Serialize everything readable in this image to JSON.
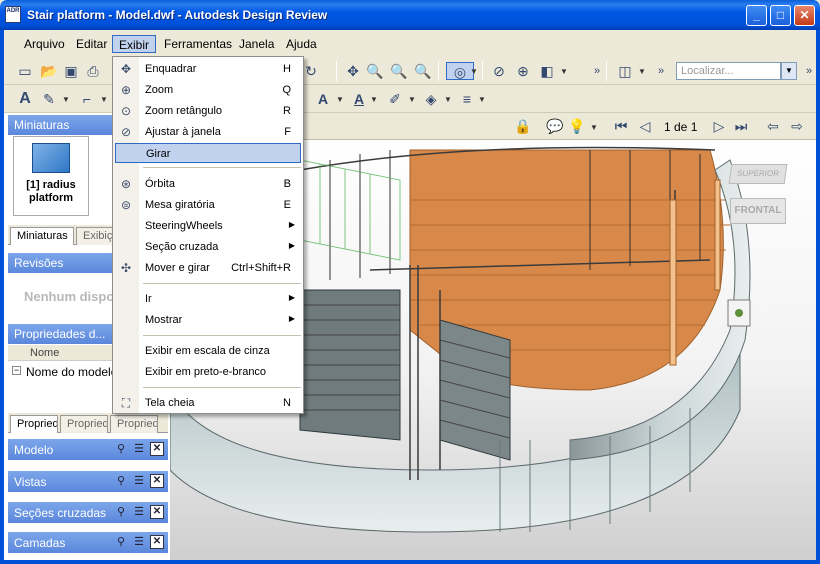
{
  "window": {
    "icon_text": "ADR",
    "title": "Stair platform - Model.dwf - Autodesk Design Review",
    "minimize": "_",
    "maximize": "□",
    "close": "✕"
  },
  "menubar": [
    {
      "label": "Arquivo",
      "key": "menu-arquivo"
    },
    {
      "label": "Editar",
      "key": "menu-editar"
    },
    {
      "label": "Exibir",
      "key": "menu-exibir"
    },
    {
      "label": "Ferramentas",
      "key": "menu-ferramentas"
    },
    {
      "label": "Janela",
      "key": "menu-janela"
    },
    {
      "label": "Ajuda",
      "key": "menu-ajuda"
    }
  ],
  "toolbar": {
    "search_placeholder": "Localizar...",
    "page_indicator": "1 de 1"
  },
  "exibir_menu": [
    {
      "label": "Enquadrar",
      "shortcut": "H",
      "icon": "pan-icon"
    },
    {
      "label": "Zoom",
      "shortcut": "Q",
      "icon": "zoom-icon"
    },
    {
      "label": "Zoom retângulo",
      "shortcut": "R",
      "icon": "zoom-rect-icon"
    },
    {
      "label": "Ajustar à janela",
      "shortcut": "F",
      "icon": "fit-window-icon"
    },
    {
      "label": "Girar",
      "shortcut": "",
      "icon": "",
      "highlighted": true
    },
    {
      "label": "Órbita",
      "shortcut": "B",
      "icon": "orbit-icon"
    },
    {
      "label": "Mesa giratória",
      "shortcut": "E",
      "icon": "turntable-icon"
    },
    {
      "label": "SteeringWheels",
      "shortcut": "",
      "submenu": true
    },
    {
      "label": "Seção cruzada",
      "shortcut": "",
      "submenu": true
    },
    {
      "label": "Mover e girar",
      "shortcut": "Ctrl+Shift+R",
      "icon": "move-rotate-icon"
    },
    {
      "label": "Ir",
      "shortcut": "",
      "submenu": true
    },
    {
      "label": "Mostrar",
      "shortcut": "",
      "submenu": true
    },
    {
      "label": "Exibir em escala de cinza",
      "shortcut": ""
    },
    {
      "label": "Exibir em preto-e-branco",
      "shortcut": ""
    },
    {
      "label": "Tela cheia",
      "shortcut": "N",
      "icon": "fullscreen-icon"
    }
  ],
  "left_panel": {
    "miniaturas_header": "Miniaturas",
    "thumbnail_label_1": "[1] radius",
    "thumbnail_label_2": "platform",
    "tab_miniaturas": "Miniaturas",
    "tab_exibicoes": "Exibiçõ",
    "revisoes_header": "Revisões",
    "revisoes_empty": "Nenhum dispo",
    "propriedades_header": "Propriedades d...",
    "props_col_nome": "Nome",
    "props_row": "Nome do modelo",
    "tab_prop1": "Propried",
    "tab_prop2": "Propried",
    "tab_prop3": "Propried",
    "modelo_header": "Modelo",
    "vistas_header": "Vistas",
    "secoes_header": "Seções cruzadas",
    "camadas_header": "Camadas"
  },
  "viewcube": {
    "top": "SUPERIOR",
    "front": "FRONTAL"
  },
  "colors": {
    "titlebar": "#0050d8",
    "menu_highlight": "#c1d2ee",
    "panel_header": "#6b95e0",
    "platform_orange": "#d8894a"
  }
}
